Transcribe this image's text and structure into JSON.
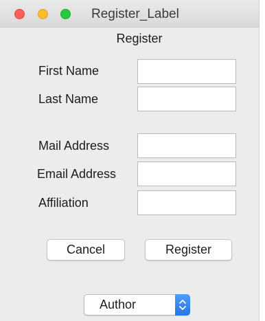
{
  "window": {
    "title": "Register_Label"
  },
  "form": {
    "heading": "Register",
    "first_name_label": "First Name",
    "first_name_value": "",
    "last_name_label": "Last Name",
    "last_name_value": "",
    "mail_address_label": "Mail Address",
    "mail_address_value": "",
    "email_address_label": "Email Address",
    "email_address_value": "",
    "affiliation_label": "Affiliation",
    "affiliation_value": ""
  },
  "buttons": {
    "cancel_label": "Cancel",
    "register_label": "Register"
  },
  "role_select": {
    "selected": "Author"
  },
  "colors": {
    "close": "#fc5f57",
    "minimize": "#fdbc2e",
    "zoom": "#28c840",
    "select_accent": "#3b86f0"
  }
}
